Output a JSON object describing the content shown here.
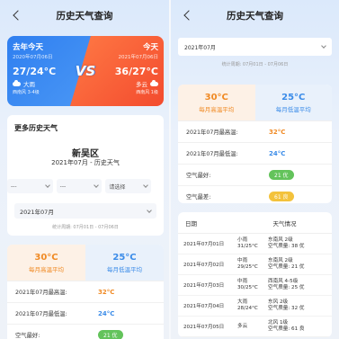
{
  "nav": {
    "title": "历史天气查询"
  },
  "compare": {
    "last_year": {
      "title": "去年今天",
      "date": "2020年07月06日",
      "temp": "27/24°C",
      "weather": "大雨",
      "wind": "西南风 3-4级"
    },
    "today": {
      "title": "今天",
      "date": "2021年07月06日",
      "temp": "36/27°C",
      "weather": "多云",
      "wind": "西南风 1级"
    },
    "vs": "VS"
  },
  "more": {
    "title": "更多历史天气",
    "district": "新吴区",
    "subtitle": "2021年07月 - 历史天气",
    "selects": [
      "---",
      "---",
      "请选择"
    ],
    "month": "2021年07月",
    "range": "统计周期: 07月01日 - 07月06日"
  },
  "stats": {
    "high_avg": "30°C",
    "high_avg_label": "每月高温平均",
    "low_avg": "25°C",
    "low_avg_label": "每月低温平均",
    "max_high_label": "2021年07月最高温:",
    "max_high": "32°C",
    "min_low_label": "2021年07月最低温:",
    "min_low": "24°C",
    "best_air_label": "空气最好:",
    "best_air": "21 优",
    "worst_air_label": "空气最差:",
    "worst_air": "61 良"
  },
  "right": {
    "month": "2021年07月",
    "range": "统计周期: 07月01日 - 07月06日",
    "table_headers": [
      "日期",
      "天气情况"
    ],
    "rows": [
      {
        "date": "2021年07月01日",
        "weather": "小雨",
        "temp": "31/25°C",
        "wind": "东南风 2级",
        "air": "空气质量: 38 优"
      },
      {
        "date": "2021年07月02日",
        "weather": "中雨",
        "temp": "29/25°C",
        "wind": "东南风 2级",
        "air": "空气质量: 21 优"
      },
      {
        "date": "2021年07月03日",
        "weather": "中雨",
        "temp": "30/25°C",
        "wind": "西南风 4-5级",
        "air": "空气质量: 25 优"
      },
      {
        "date": "2021年07月04日",
        "weather": "大雨",
        "temp": "28/24°C",
        "wind": "东风 2级",
        "air": "空气质量: 32 优"
      },
      {
        "date": "2021年07月05日",
        "weather": "多云",
        "temp": "",
        "wind": "北风 1级",
        "air": "空气质量: 61 良"
      }
    ]
  }
}
